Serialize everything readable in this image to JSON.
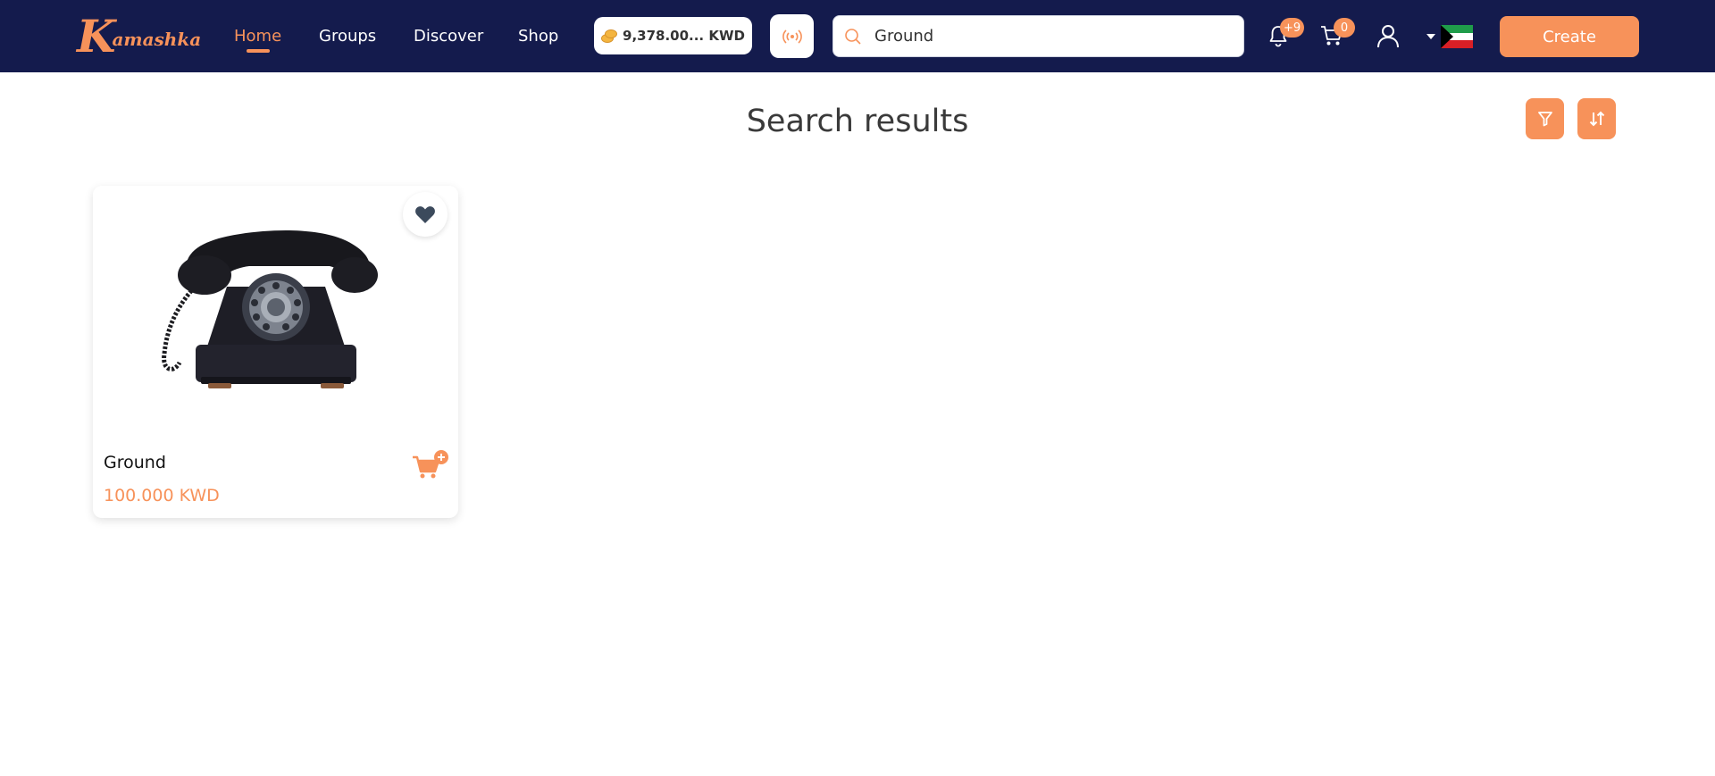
{
  "brand": {
    "logo_initial": "K",
    "logo_rest": "amashka"
  },
  "nav": {
    "home": "Home",
    "groups": "Groups",
    "discover": "Discover",
    "shop": "Shop"
  },
  "wallet": {
    "balance": "9,378.00... KWD"
  },
  "search": {
    "value": "Ground",
    "placeholder": ""
  },
  "notifications": {
    "count": "+9"
  },
  "cart": {
    "count": "0"
  },
  "language": {
    "flag": "kuwait-flag"
  },
  "create_label": "Create",
  "main": {
    "title": "Search results"
  },
  "results": [
    {
      "name": "Ground",
      "price": "100.000 KWD",
      "image": "rotary-telephone-image"
    }
  ],
  "colors": {
    "navbar": "#141b4d",
    "accent": "#f7925a",
    "favorite_icon": "#3c4a5c"
  }
}
